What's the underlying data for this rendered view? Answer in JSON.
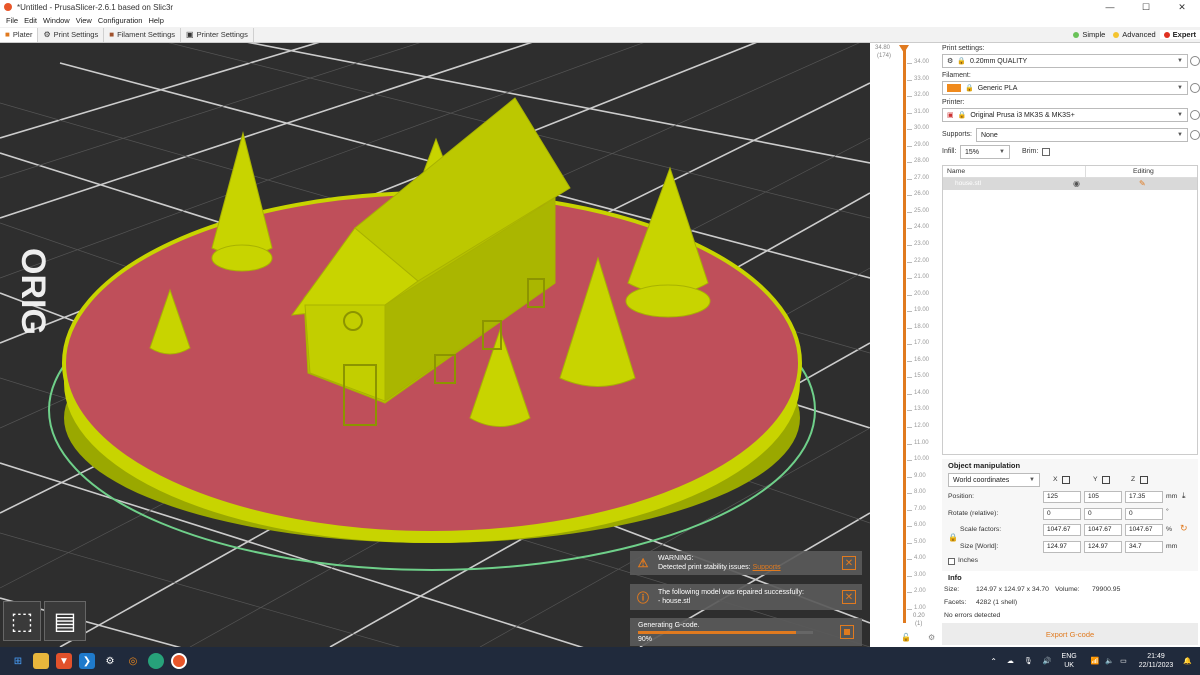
{
  "window": {
    "title": "*Untitled - PrusaSlicer-2.6.1 based on Slic3r",
    "min": "—",
    "max": "☐",
    "close": "✕"
  },
  "menu": [
    "File",
    "Edit",
    "Window",
    "View",
    "Configuration",
    "Help"
  ],
  "tabs": [
    "Plater",
    "Print Settings",
    "Filament Settings",
    "Printer Settings"
  ],
  "modes": {
    "simple": "Simple",
    "advanced": "Advanced",
    "expert": "Expert"
  },
  "viewport": {
    "bed_label": "ORIG"
  },
  "notifications": {
    "warning_title": "WARNING:",
    "warning_text": "Detected print stability issues:",
    "warning_link": "Supports",
    "repair_text": "The following model was repaired successfully:",
    "repair_file": "- house.stl",
    "progress_label": "Generating G-code.",
    "progress_value": "90%",
    "progress_fraction": 0.9
  },
  "ruler": {
    "top_value": "34.80",
    "top_layer": "(174)",
    "bottom_value": "0.20",
    "bottom_layer": "(1)",
    "ticks": [
      "34.00",
      "33.00",
      "32.00",
      "31.00",
      "30.00",
      "29.00",
      "28.00",
      "27.00",
      "26.00",
      "25.00",
      "24.00",
      "23.00",
      "22.00",
      "21.00",
      "20.00",
      "19.00",
      "18.00",
      "17.00",
      "16.00",
      "15.00",
      "14.00",
      "13.00",
      "12.00",
      "11.00",
      "10.00",
      "9.00",
      "8.00",
      "7.00",
      "6.00",
      "5.00",
      "4.00",
      "3.00",
      "2.00",
      "1.00"
    ]
  },
  "panel": {
    "print_settings_label": "Print settings:",
    "print_settings_value": "0.20mm QUALITY",
    "filament_label": "Filament:",
    "filament_value": "Generic PLA",
    "filament_color": "#f08a1c",
    "printer_label": "Printer:",
    "printer_value": "Original Prusa i3 MK3S & MK3S+",
    "supports_label": "Supports:",
    "supports_value": "None",
    "infill_label": "Infill:",
    "infill_value": "15%",
    "brim_label": "Brim:",
    "col_name": "Name",
    "col_editing": "Editing",
    "object_name": "house.stl",
    "om_title": "Object manipulation",
    "coords": "World coordinates",
    "x": "X",
    "y": "Y",
    "z": "Z",
    "position_label": "Position:",
    "position": [
      "125",
      "105",
      "17.35"
    ],
    "mm": "mm",
    "rotate_label": "Rotate (relative):",
    "rotate": [
      "0",
      "0",
      "0"
    ],
    "deg": "°",
    "scale_label": "Scale factors:",
    "scale": [
      "1047.67",
      "1047.67",
      "1047.67"
    ],
    "pct": "%",
    "size_label": "Size [World]:",
    "size": [
      "124.97",
      "124.97",
      "34.7"
    ],
    "mm2": "mm",
    "inches": "Inches",
    "info_title": "Info",
    "size_info_label": "Size:",
    "size_info": "124.97 x 124.97 x 34.70",
    "volume_label": "Volume:",
    "volume": "79900.95",
    "facets_label": "Facets:",
    "facets": "4282 (1 shell)",
    "no_errors": "No errors detected",
    "export": "Export G-code"
  },
  "tray": {
    "lang1": "ENG",
    "lang2": "UK",
    "time": "21:49",
    "date": "22/11/2023"
  },
  "colors": {
    "accent": "#e07a1f",
    "model": "#c8d400",
    "bed": "#c0505a",
    "scene": "#333333"
  }
}
